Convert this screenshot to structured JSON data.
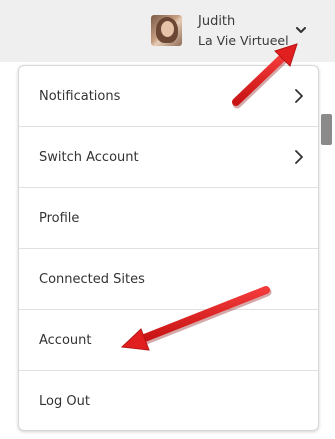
{
  "header": {
    "user_name": "Judith",
    "site_name": "La Vie Virtueel",
    "avatar_icon": "user-avatar",
    "dropdown_icon": "chevron-down-icon"
  },
  "menu": {
    "items": [
      {
        "label": "Notifications",
        "has_submenu": true
      },
      {
        "label": "Switch Account",
        "has_submenu": true
      },
      {
        "label": "Profile",
        "has_submenu": false
      },
      {
        "label": "Connected Sites",
        "has_submenu": false
      },
      {
        "label": "Account",
        "has_submenu": false
      },
      {
        "label": "Log Out",
        "has_submenu": false
      }
    ]
  },
  "annotation_color": "#e21f1f"
}
